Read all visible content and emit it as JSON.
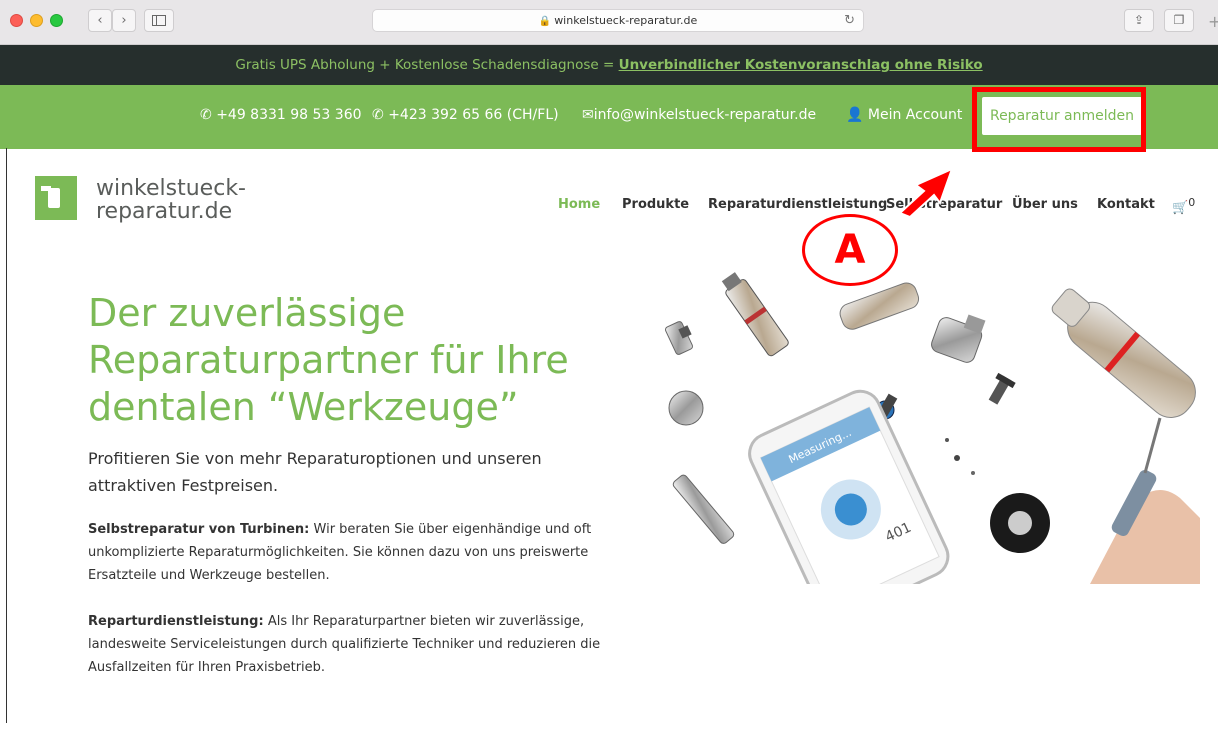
{
  "browser": {
    "url": "winkelstueck-reparatur.de"
  },
  "topbar": {
    "text": "Gratis UPS Abholung + Kostenlose Schadensdiagnose = ",
    "link": "Unverbindlicher Kostenvoranschlag ohne Risiko"
  },
  "contact": {
    "phone_de": "+49 8331 98 53 360",
    "phone_ch": "+423 392 65 66 (CH/FL)",
    "email": "info@winkelstueck-reparatur.de",
    "account": "Mein Account",
    "cta": "Reparatur anmelden"
  },
  "logo": {
    "line1": "winkelstueck-",
    "line2": "reparatur.de"
  },
  "nav": {
    "home": "Home",
    "products": "Produkte",
    "repair_service": "Reparaturdienstleistung",
    "self_repair": "Selbstreparatur",
    "about": "Über uns",
    "contact": "Kontakt",
    "cart_count": "0"
  },
  "annotation": {
    "label": "A"
  },
  "hero": {
    "title_1": "Der zuverlässige",
    "title_2": "Reparaturpartner für Ihre",
    "title_3": "dentalen “Werkzeuge”",
    "lead": "Profitieren Sie von mehr Reparaturoptionen und unseren attraktiven Festpreisen.",
    "p1_bold": "Selbstreparatur von Turbinen:",
    "p1_text": " Wir beraten Sie über eigenhändige und oft unkomplizierte Reparaturmöglichkeiten. Sie können dazu von uns preiswerte Ersatzteile und Werkzeuge bestellen.",
    "p2_bold": "Reparturdienstleistung:",
    "p2_text": " Als Ihr Reparaturpartner bieten wir zuverlässige, landesweite Serviceleistungen durch qualifizierte Techniker und reduzieren die Ausfallzeiten für Ihren Praxisbetrieb."
  },
  "phone_screen": {
    "measuring": "Measuring...",
    "value": "401"
  },
  "colors": {
    "brand_green": "#7cba56",
    "topbar_dark": "#262f2d",
    "annotation_red": "#ff0000"
  }
}
